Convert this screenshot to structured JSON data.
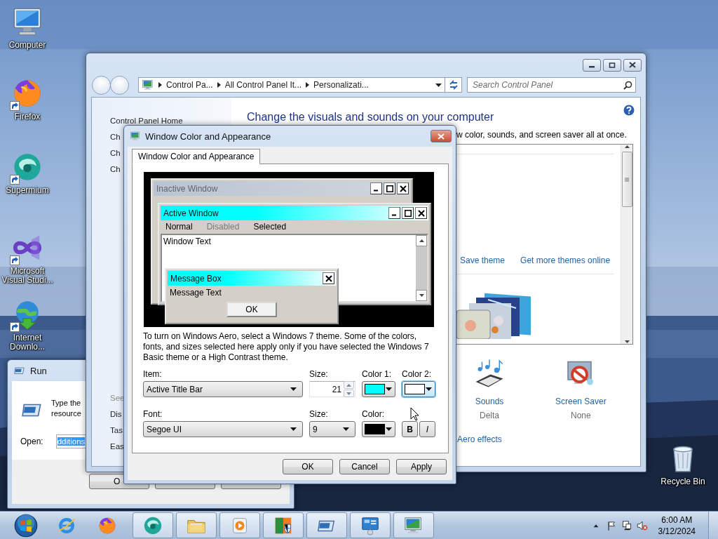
{
  "desktop_icons": [
    {
      "label": "Computer",
      "kind": "computer",
      "shortcut": false
    },
    {
      "label": "Firefox",
      "kind": "firefox",
      "shortcut": true
    },
    {
      "label": "Supermium",
      "kind": "supermium",
      "shortcut": true
    },
    {
      "label": "Microsoft Visual Studi...",
      "kind": "visualstudio",
      "shortcut": true
    },
    {
      "label": "Internet Downlo...",
      "kind": "idm",
      "shortcut": true
    },
    {
      "label": "Recycle Bin",
      "kind": "recycle",
      "shortcut": false
    }
  ],
  "run_dialog": {
    "title": "Run",
    "prompt_lines": [
      "Type the",
      "resource"
    ],
    "open_label": "Open:",
    "open_value": "dditions",
    "open_value_selected": true,
    "buttons": [
      {
        "kind": "labeled",
        "label": "O"
      },
      {
        "kind": "covered"
      },
      {
        "kind": "covered"
      }
    ]
  },
  "control_panel": {
    "breadcrumbs": [
      "Control Pa...",
      "All Control Panel It...",
      "Personalizati..."
    ],
    "search_placeholder": "Search Control Panel",
    "sidebar_top": [
      {
        "label": "Control Panel Home"
      },
      {
        "label": "Ch"
      },
      {
        "label": "Ch"
      },
      {
        "label": "Ch"
      }
    ],
    "sidebar_bottom": [
      {
        "label": "See",
        "kind": "heading"
      },
      {
        "label": "Dis",
        "kind": "link"
      },
      {
        "label": "Tas",
        "kind": "link"
      },
      {
        "label": "Eas",
        "kind": "link"
      }
    ],
    "heading": "Change the visuals and sounds on your computer",
    "description": "w color, sounds, and screen saver all at once.",
    "theme_links": [
      "Save theme",
      "Get more themes online"
    ],
    "settings": [
      {
        "label": "Sounds",
        "value": "Delta",
        "kind": "sounds"
      },
      {
        "label": "Screen Saver",
        "value": "None",
        "kind": "screensaver"
      }
    ],
    "aero_link": "Aero effects"
  },
  "dialog": {
    "title": "Window Color and Appearance",
    "tabs": [
      {
        "label": "Window Color and Appearance",
        "selected": true
      }
    ],
    "preview": {
      "inactive_title": "Inactive Window",
      "active_title": "Active Window",
      "menu": [
        {
          "label": "Normal",
          "disabled": false
        },
        {
          "label": "Disabled",
          "disabled": true
        },
        {
          "label": "Selected",
          "disabled": false
        }
      ],
      "window_text": "Window Text",
      "message_title": "Message Box",
      "message_text": "Message Text",
      "message_button": "OK"
    },
    "description": "To turn on Windows Aero, select a Windows 7 theme.  Some of the colors, fonts, and sizes selected here apply only if you have selected the Windows 7 Basic theme or a High Contrast theme.",
    "item": {
      "label": "Item:",
      "value": "Active Title Bar"
    },
    "item_size": {
      "label": "Size:",
      "value": "21"
    },
    "item_colors": [
      {
        "label": "Color 1:",
        "color": "#00ffff",
        "focused": false
      },
      {
        "label": "Color 2:",
        "color": "#ffffff",
        "focused": true
      }
    ],
    "font": {
      "label": "Font:",
      "value": "Segoe UI"
    },
    "font_size": {
      "label": "Size:",
      "value": "9"
    },
    "font_color": {
      "label": "Color:",
      "color": "#000000",
      "focused": false
    },
    "style_buttons": [
      {
        "label": "B",
        "kind": "bold"
      },
      {
        "label": "I",
        "kind": "italic"
      }
    ],
    "buttons": [
      "OK",
      "Cancel",
      "Apply"
    ]
  },
  "taskbar": {
    "pinned": [
      {
        "kind": "start"
      },
      {
        "kind": "ie"
      },
      {
        "kind": "firefox"
      }
    ],
    "tasks": [
      {
        "kind": "supermium"
      },
      {
        "kind": "explorer"
      },
      {
        "kind": "media"
      },
      {
        "kind": "installer"
      },
      {
        "kind": "run"
      },
      {
        "kind": "controlpanel"
      },
      {
        "kind": "display"
      }
    ],
    "tray": [
      {
        "kind": "show-hidden"
      },
      {
        "kind": "flag"
      },
      {
        "kind": "network"
      },
      {
        "kind": "volume-muted"
      }
    ],
    "time": "6:00 AM",
    "date": "3/12/2024"
  }
}
